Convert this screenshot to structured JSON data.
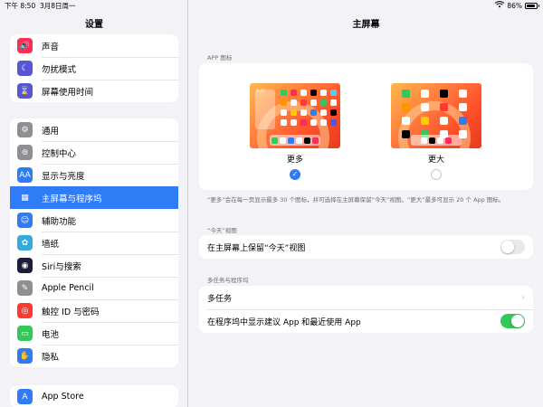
{
  "status": {
    "time": "下午 8:50",
    "date": "3月8日周一",
    "battery": "86%",
    "battery_level": 0.86
  },
  "sidebar": {
    "title": "设置",
    "group1": [
      {
        "label": "声音",
        "icon": "speaker-icon",
        "color": "#ff2d55",
        "glyph": "🔊"
      },
      {
        "label": "勿扰模式",
        "icon": "moon-icon",
        "color": "#5856d6",
        "glyph": "☾"
      },
      {
        "label": "屏幕使用时间",
        "icon": "hourglass-icon",
        "color": "#5856d6",
        "glyph": "⌛"
      }
    ],
    "group2": [
      {
        "label": "通用",
        "icon": "gear-icon",
        "color": "#8e8e93",
        "glyph": "⚙"
      },
      {
        "label": "控制中心",
        "icon": "switches-icon",
        "color": "#8e8e93",
        "glyph": "⊜"
      },
      {
        "label": "显示与亮度",
        "icon": "text-size-icon",
        "color": "#2f7cf6",
        "glyph": "AA"
      },
      {
        "label": "主屏幕与程序坞",
        "icon": "home-grid-icon",
        "color": "#2f7cf6",
        "glyph": "▦",
        "selected": true
      },
      {
        "label": "辅助功能",
        "icon": "accessibility-icon",
        "color": "#2f7cf6",
        "glyph": "☺"
      },
      {
        "label": "墙纸",
        "icon": "flower-icon",
        "color": "#34aadc",
        "glyph": "✿"
      },
      {
        "label": "Siri与搜索",
        "icon": "siri-icon",
        "color": "#1c1c3c",
        "glyph": "◉"
      },
      {
        "label": "Apple Pencil",
        "icon": "pencil-icon",
        "color": "#8e8e93",
        "glyph": "✎"
      },
      {
        "label": "触控 ID 与密码",
        "icon": "fingerprint-icon",
        "color": "#ff3b30",
        "glyph": "◎"
      },
      {
        "label": "电池",
        "icon": "battery-icon",
        "color": "#34c759",
        "glyph": "▭"
      },
      {
        "label": "隐私",
        "icon": "hand-icon",
        "color": "#2f7cf6",
        "glyph": "✋"
      }
    ],
    "group3": [
      {
        "label": "App Store",
        "icon": "app-store-icon",
        "color": "#2f7cf6",
        "glyph": "A"
      }
    ]
  },
  "main": {
    "title": "主屏幕",
    "app_icons_header": "APP 图标",
    "preview_time": "9:41",
    "options": [
      {
        "label": "更多",
        "checked": true
      },
      {
        "label": "更大",
        "checked": false
      }
    ],
    "note": "“更多”会在每一页显示最多 30 个图标，并可选择在主屏幕保留“今天”视图。“更大”最多可显示 20 个 App 图标。",
    "today_header": "“今天”视图",
    "today_row": {
      "label": "在主屏幕上保留“今天”视图",
      "on": false
    },
    "multitask_header": "多任务与程序坞",
    "multitask_row": "多任务",
    "dock_row": {
      "label": "在程序坞中显示建议 App 和最近使用 App",
      "on": true
    }
  }
}
